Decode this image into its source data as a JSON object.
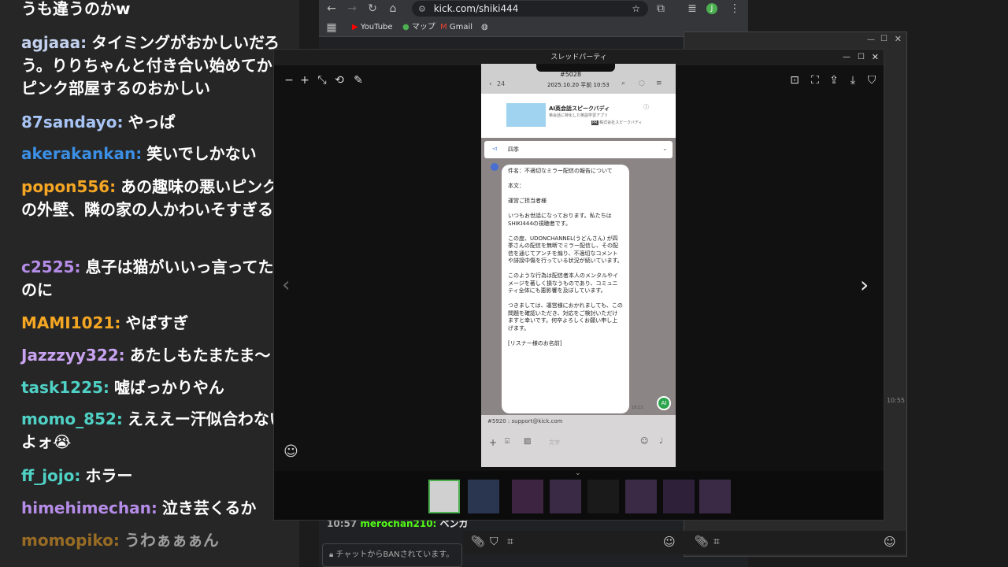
{
  "chat": {
    "messages": [
      {
        "user": "",
        "text": "うも違うのかw",
        "color": "#ffffff"
      },
      {
        "user": "agjaaa:",
        "text": "タイミングがおかしいだろう。りりちゃんと付き合い始めてからピンク部屋するのおかしい",
        "color": "#c3d1ee"
      },
      {
        "user": "87sandayo:",
        "text": "やっぱ",
        "color": "#a7c4f5"
      },
      {
        "user": "akerakankan:",
        "text": "笑いでしかない",
        "color": "#3b8fe5"
      },
      {
        "user": "popon556:",
        "text": "あの趣味の悪いピンクの外壁、隣の家の人かわいそすぎる",
        "color": "#f5a623"
      },
      {
        "user": "c2525:",
        "text": "息子は猫がいいっ言ってたのに",
        "color": "#b58ce8"
      },
      {
        "user": "MAMI1021:",
        "text": "やばすぎ",
        "color": "#f5a623"
      },
      {
        "user": "Jazzzyy322:",
        "text": "あたしもたまたま〜",
        "color": "#c7a3f0"
      },
      {
        "user": "task1225:",
        "text": "嘘ばっかりやん",
        "color": "#4fd1c5"
      },
      {
        "user": "momo_852:",
        "text": "えええー汗似合わないよォ😭",
        "color": "#4fd1c5"
      },
      {
        "user": "ff_jojo:",
        "text": "ホラー",
        "color": "#4fd1c5"
      },
      {
        "user": "himehimechan:",
        "text": "泣き芸くるか",
        "color": "#b58ce8"
      },
      {
        "user": "momopiko:",
        "text": "うわぁぁぁん",
        "color": "#f5a623"
      }
    ]
  },
  "browser": {
    "url": "kick.com/shiki444",
    "bookmarks": [
      "YouTube",
      "マップ",
      "Gmail"
    ],
    "chat_line": {
      "time": "10:57",
      "user": "merochan210:",
      "text": "ベンガ"
    },
    "chat_input_placeholder": "チャットからBANされています。"
  },
  "viewer": {
    "title": "スレッドパーティ",
    "phone": {
      "id": "#5028",
      "back_count": "24",
      "date": "2025.10.20 平前 10:53",
      "ad_title": "AI英会話スピークバディ",
      "ad_sub": "英会話に特化した英語学習アプリ",
      "ad_company": "株式会社スピークバディ",
      "ad_tag": "PR",
      "sender": "四季",
      "msg_lines": [
        "件名：不適切なミラー配信の報告について",
        "",
        "本文：",
        "",
        "運営ご担当者様",
        "",
        "いつもお世話になっております。私たちはSHIKI444の視聴者です。",
        "",
        "この度、UDONCHANNEL(うどんさん) が四季さんの配信を無断でミラー配信し、その配信を通じてアンチを煽り、不適切なコメントや誹謗中傷を行っている状況が続いています。",
        "",
        "このような行為は配信者本人のメンタルやイメージを著しく損なうものであり、コミュニティ全体にも悪影響を及ぼしています。",
        "",
        "つきましては、運営様におかれましても、この問題を確認いただき、対応をご検討いただけますと幸いです。何卒よろしくお願い申し上げます。",
        "",
        "[リスナー様のお名前]"
      ],
      "msg_time": "18:13",
      "ai_badge": "AI",
      "email_line": "#5920 : support@kick.com",
      "input_placeholder": "文字"
    }
  },
  "right_window": {
    "timestamp": "10:55"
  },
  "colors": {
    "chat_bg": "#262626",
    "viewer_bg": "#111111",
    "accent_green": "#53fc18",
    "thumb_selected": "#4caf50"
  }
}
